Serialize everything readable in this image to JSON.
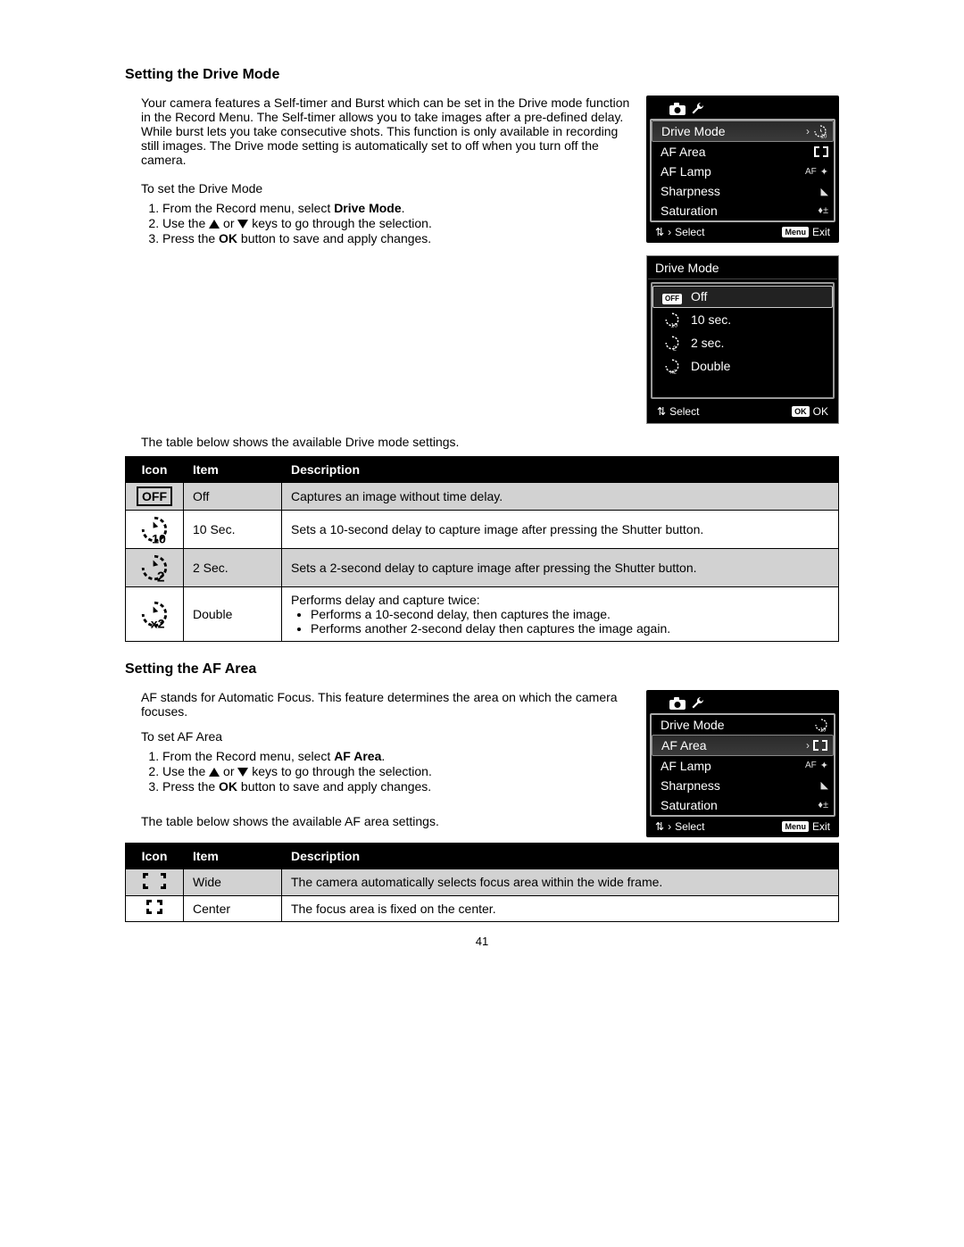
{
  "section1": {
    "heading": "Setting the Drive Mode",
    "intro": "Your camera features a Self-timer and Burst which can be set in the Drive mode function in the Record Menu. The Self-timer allows you to take images after a pre-defined delay. While burst lets you take consecutive shots. This function is only available in recording still images. The Drive mode setting is automatically set to off when you turn off the camera.",
    "howto_title": "To set the Drive Mode",
    "steps": {
      "s1a": "From the Record menu, select ",
      "s1b": "Drive Mode",
      "s1c": ".",
      "s2a": "Use the ",
      "s2b": " or ",
      "s2c": " keys to go through the selection.",
      "s3a": "Press the ",
      "s3b": "OK",
      "s3c": " button to save and apply changes."
    },
    "table_intro": "The table below shows the available Drive mode settings."
  },
  "screen1": {
    "items": [
      "Drive Mode",
      "AF Area",
      "AF Lamp",
      "Sharpness",
      "Saturation"
    ],
    "foot_select": "Select",
    "foot_menu": "Menu",
    "foot_exit": "Exit",
    "af_badge": "AF"
  },
  "screen2": {
    "title": "Drive Mode",
    "opts": [
      "Off",
      "10 sec.",
      "2 sec.",
      "Double"
    ],
    "foot_select": "Select",
    "foot_ok": "OK",
    "foot_ok2": "OK"
  },
  "table1": {
    "h_icon": "Icon",
    "h_item": "Item",
    "h_desc": "Description",
    "r1_item": "Off",
    "r1_desc": "Captures an image without time delay.",
    "r2_item": "10 Sec.",
    "r2_desc": "Sets a 10-second delay to capture image after pressing the Shutter button.",
    "r3_item": "2 Sec.",
    "r3_desc": "Sets a 2-second delay to capture image after pressing the Shutter button.",
    "r4_item": "Double",
    "r4_desc_line": "Performs delay and capture twice:",
    "r4_b1": "Performs a 10-second delay, then captures the image.",
    "r4_b2": "Performs another 2-second delay then captures the image again."
  },
  "section2": {
    "heading": "Setting the AF Area",
    "intro": "AF stands for Automatic Focus. This feature determines the area on which the camera focuses.",
    "howto_title": "To set AF Area",
    "steps": {
      "s1a": "From the Record menu, select ",
      "s1b": "AF Area",
      "s1c": ".",
      "s2a": "Use the ",
      "s2b": " or ",
      "s2c": " keys to go through the selection.",
      "s3a": "Press the ",
      "s3b": "OK",
      "s3c": " button to save and apply changes."
    },
    "table_intro": "The table below shows the available AF area settings."
  },
  "screen3": {
    "items": [
      "Drive Mode",
      "AF Area",
      "AF Lamp",
      "Sharpness",
      "Saturation"
    ],
    "foot_select": "Select",
    "foot_menu": "Menu",
    "foot_exit": "Exit",
    "af_badge": "AF"
  },
  "table2": {
    "h_icon": "Icon",
    "h_item": "Item",
    "h_desc": "Description",
    "r1_item": "Wide",
    "r1_desc": "The camera automatically selects focus area within the wide frame.",
    "r2_item": "Center",
    "r2_desc": "The focus area is fixed on the center."
  },
  "page_number": "41",
  "icons": {
    "off": "OFF"
  }
}
